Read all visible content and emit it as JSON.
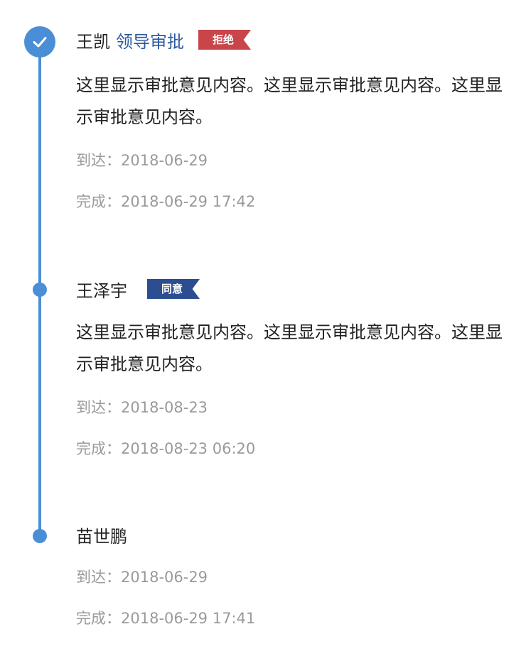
{
  "colors": {
    "accent": "#4a8fd6",
    "role": "#2c5aa0",
    "reject": "#c9454a",
    "agree": "#2c4e91"
  },
  "entries": [
    {
      "name": "王凯",
      "role": "领导审批",
      "badge": "拒绝",
      "node_icon": "check-icon",
      "comment": "这里显示审批意见内容。这里显示审批意见内容。这里显示审批意见内容。",
      "arrive_label": "到达：",
      "arrive_value": "2018-06-29",
      "complete_label": "完成：",
      "complete_value": "2018-06-29 17:42"
    },
    {
      "name": "王泽宇",
      "badge": "同意",
      "comment": "这里显示审批意见内容。这里显示审批意见内容。这里显示审批意见内容。",
      "arrive_label": "到达：",
      "arrive_value": "2018-08-23",
      "complete_label": "完成：",
      "complete_value": "2018-08-23 06:20"
    },
    {
      "name": "苗世鹏",
      "arrive_label": "到达：",
      "arrive_value": "2018-06-29",
      "complete_label": "完成：",
      "complete_value": "2018-06-29 17:41"
    }
  ]
}
